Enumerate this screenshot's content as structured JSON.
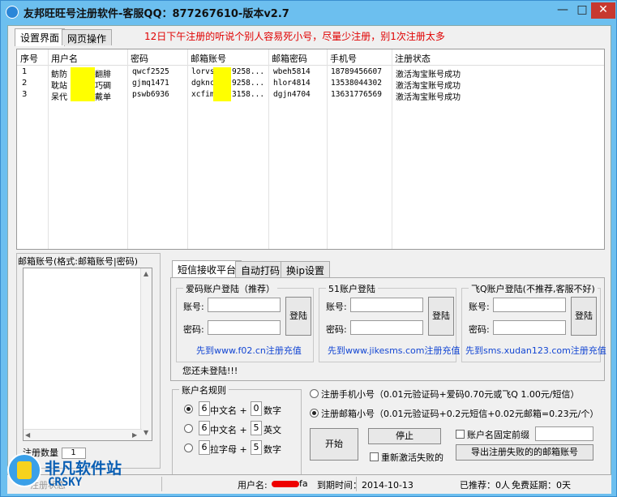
{
  "window": {
    "title_prefix": "友邦旺旺号注册软件-客服QQ：",
    "qq": "877267610",
    "version": "-版本v2.7",
    "min": "—",
    "max": "□",
    "close": "✕"
  },
  "top_tabs": [
    {
      "label": "设置界面"
    },
    {
      "label": "网页操作"
    }
  ],
  "notice": "12日下午注册的听说个别人容易死小号，尽量少注册，别1次注册太多",
  "grid": {
    "columns": [
      "序号",
      "用户名",
      "密码",
      "邮箱账号",
      "邮箱密码",
      "手机号",
      "注册状态"
    ],
    "rows": [
      {
        "no": "1",
        "user_a": "鲂防",
        "user_b": "翻腓",
        "pwd": "qwcf2525",
        "mail_a": "lorvs",
        "mail_b": "9258...",
        "mail_pwd": "wbeh5814",
        "phone": "18789456607",
        "status": "激活淘宝账号成功"
      },
      {
        "no": "2",
        "user_a": "耽站",
        "user_b": "巧碉",
        "pwd": "gjmq1471",
        "mail_a": "dgknc",
        "mail_b": "9258...",
        "mail_pwd": "hlor4814",
        "phone": "13538044302",
        "status": "激活淘宝账号成功"
      },
      {
        "no": "3",
        "user_a": "呆代",
        "user_b": "戴单",
        "pwd": "pswb6936",
        "mail_a": "xcfim",
        "mail_b": "3158...",
        "mail_pwd": "dgjn4704",
        "phone": "13631776569",
        "status": "激活淘宝账号成功"
      }
    ]
  },
  "email_panel": {
    "label": "邮箱账号(格式:邮箱账号|密码)",
    "count_label": "注册数量",
    "count_value": "1"
  },
  "mid_tabs": [
    {
      "label": "短信接收平台"
    },
    {
      "label": "自动打码"
    },
    {
      "label": "换ip设置"
    }
  ],
  "sms": {
    "aima": {
      "title": "爱码账户登陆（推荐）",
      "account": "账号:",
      "password": "密码:",
      "login": "登陆",
      "link": "先到www.f02.cn注册充值"
    },
    "s51": {
      "title": "51账户登陆",
      "account": "账号:",
      "password": "密码:",
      "login": "登陆",
      "link": "先到www.jikesms.com注册充值"
    },
    "feiq": {
      "title": "飞Q账户登陆(不推荐,客服不好)",
      "account": "账号:",
      "password": "密码:",
      "login": "登陆",
      "link": "先到sms.xudan123.com注册充值"
    },
    "status": "您还未登陆!!!"
  },
  "rules": {
    "title": "账户名规则",
    "options": [
      {
        "selected": true,
        "n1": "6",
        "t1": "中文名 +",
        "n2": "0",
        "t2": "数字"
      },
      {
        "selected": false,
        "n1": "6",
        "t1": "中文名 +",
        "n2": "5",
        "t2": "英文"
      },
      {
        "selected": false,
        "n1": "6",
        "t1": "拉字母 +",
        "n2": "5",
        "t2": "数字"
      }
    ]
  },
  "register_mode": {
    "phone": {
      "selected": false,
      "label": "注册手机小号（0.01元验证码+爱码0.70元或飞Q 1.00元/短信）"
    },
    "email": {
      "selected": true,
      "label": "注册邮箱小号（0.01元验证码+0.2元短信+0.02元邮箱=0.23元/个）"
    }
  },
  "actions": {
    "start": "开始",
    "stop": "停止",
    "reactivate": "重新激活失败的",
    "prefix_label": "账户名固定前缀",
    "export": "导出注册失败的的邮箱账号"
  },
  "statusbar": {
    "user_label": "用户名:",
    "user_tail": "fa",
    "expire": "到期时间：2014-10-13",
    "recommended": "已推荐：0人",
    "free_ext": "免费延期：0天",
    "left_partial": "注册状态"
  },
  "watermark": {
    "cn": "非凡软件站",
    "en": "CRSKY"
  }
}
